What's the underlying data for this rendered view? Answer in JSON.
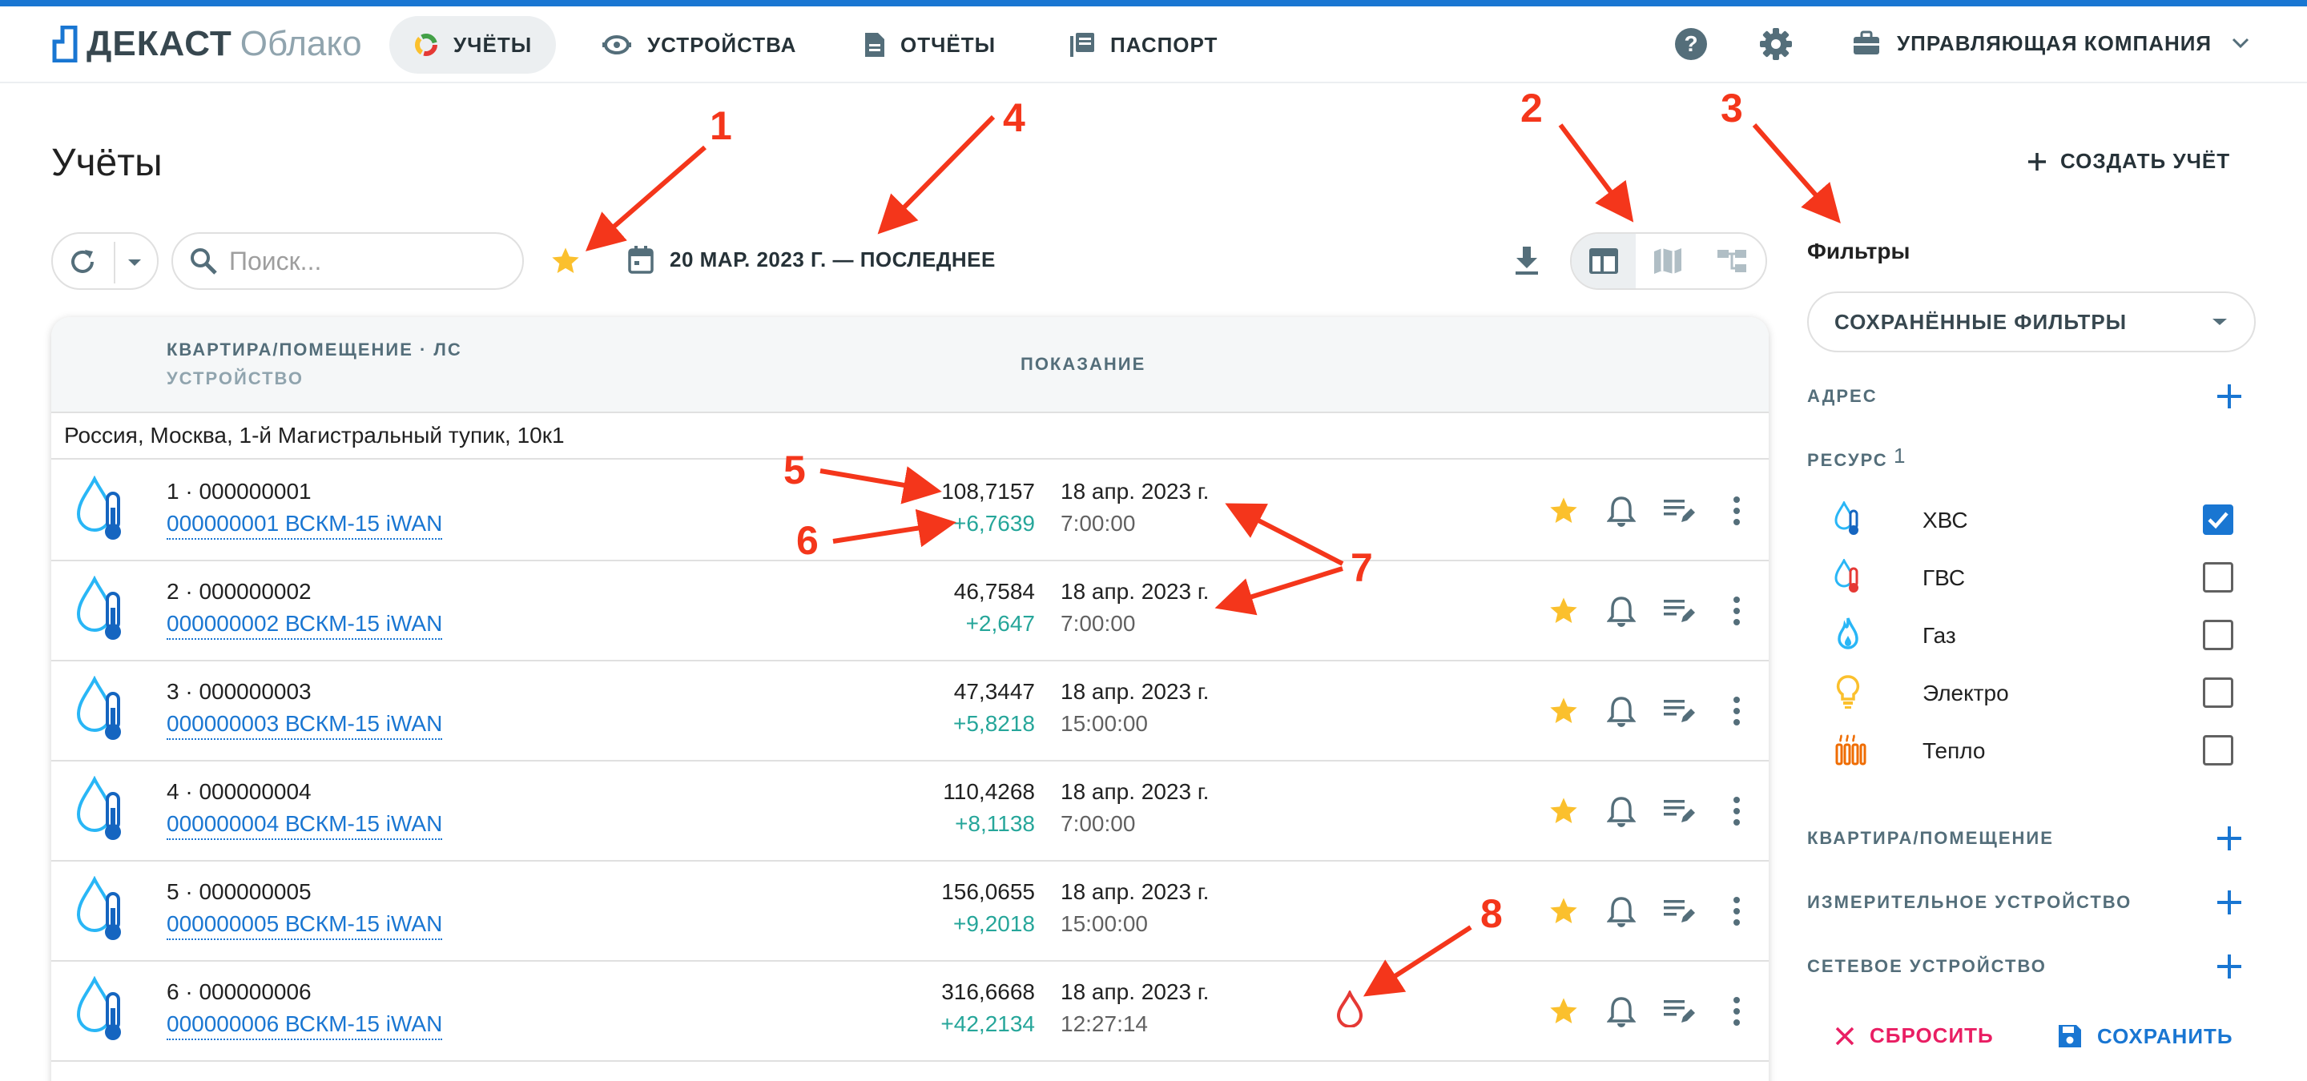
{
  "app": {
    "brand": "ДЕКАСТ",
    "brand_sub": "Облако"
  },
  "nav": {
    "items": [
      {
        "label": "УЧЁТЫ",
        "active": true
      },
      {
        "label": "УСТРОЙСТВА"
      },
      {
        "label": "ОТЧЁТЫ"
      },
      {
        "label": "ПАСПОРТ"
      }
    ],
    "company": "УПРАВЛЯЮЩАЯ КОМПАНИЯ"
  },
  "page": {
    "title": "Учёты",
    "create_label": "СОЗДАТЬ УЧЁТ"
  },
  "toolbar": {
    "search_placeholder": "Поиск...",
    "date_range": "20 МАР. 2023 Г. — ПОСЛЕДНЕЕ"
  },
  "table": {
    "header_col1": "КВАРТИРА/ПОМЕЩЕНИЕ · ЛС",
    "header_col1_sub": "УСТРОЙСТВО",
    "header_col2": "ПОКАЗАНИЕ",
    "group": "Россия, Москва, 1-й Магистральный тупик, 10к1",
    "rows": [
      {
        "account": "1  ·  000000001",
        "device": "000000001 ВСКМ-15 iWAN",
        "value": "108,7157",
        "delta": "+6,7639",
        "date": "18 апр. 2023 г.",
        "time": "7:00:00"
      },
      {
        "account": "2  ·  000000002",
        "device": "000000002 ВСКМ-15 iWAN",
        "value": "46,7584",
        "delta": "+2,647",
        "date": "18 апр. 2023 г.",
        "time": "7:00:00"
      },
      {
        "account": "3  ·  000000003",
        "device": "000000003 ВСКМ-15 iWAN",
        "value": "47,3447",
        "delta": "+5,8218",
        "date": "18 апр. 2023 г.",
        "time": "15:00:00"
      },
      {
        "account": "4  ·  000000004",
        "device": "000000004 ВСКМ-15 iWAN",
        "value": "110,4268",
        "delta": "+8,1138",
        "date": "18 апр. 2023 г.",
        "time": "7:00:00"
      },
      {
        "account": "5  ·  000000005",
        "device": "000000005 ВСКМ-15 iWAN",
        "value": "156,0655",
        "delta": "+9,2018",
        "date": "18 апр. 2023 г.",
        "time": "15:00:00"
      },
      {
        "account": "6  ·  000000006",
        "device": "000000006 ВСКМ-15 iWAN",
        "value": "316,6668",
        "delta": "+42,2134",
        "date": "18 апр. 2023 г.",
        "time": "12:27:14"
      }
    ]
  },
  "filters": {
    "title": "Фильтры",
    "saved": "СОХРАНЁННЫЕ ФИЛЬТРЫ",
    "address": "АДРЕС",
    "resource": "РЕСУРС",
    "resource_count": "1",
    "resources": [
      {
        "label": "ХВС",
        "checked": true
      },
      {
        "label": "ГВС",
        "checked": false
      },
      {
        "label": "Газ",
        "checked": false
      },
      {
        "label": "Электро",
        "checked": false
      },
      {
        "label": "Тепло",
        "checked": false
      }
    ],
    "apartment": "КВАРТИРА/ПОМЕЩЕНИЕ",
    "meter": "ИЗМЕРИТЕЛЬНОЕ УСТРОЙСТВО",
    "network": "СЕТЕВОЕ УСТРОЙСТВО",
    "reset": "СБРОСИТЬ",
    "save": "СОХРАНИТЬ"
  },
  "annotations": [
    "1",
    "2",
    "3",
    "4",
    "5",
    "6",
    "7",
    "8"
  ],
  "colors": {
    "accent": "#1976d2",
    "star": "#fbc02d",
    "delta": "#26a69a",
    "annotation": "#f4361b",
    "reset": "#e91e63"
  }
}
